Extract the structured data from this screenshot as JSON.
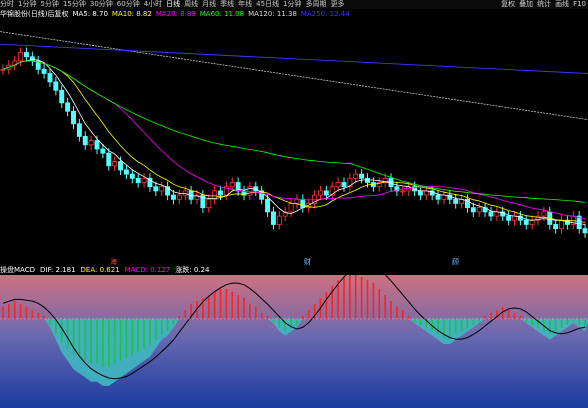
{
  "toolbar": {
    "items": [
      "分时",
      "1分钟",
      "5分钟",
      "15分钟",
      "30分钟",
      "60分钟",
      "4小时",
      "日线",
      "周线",
      "月线",
      "季线",
      "年线",
      "45日线",
      "1分钟",
      "多周期",
      "更多"
    ],
    "right": [
      "复权",
      "叠加",
      "统计",
      "画线",
      "F10"
    ]
  },
  "legend": {
    "title": "华锦股份(日线)后复权",
    "ma5": "MA5: 8.70",
    "ma10": "MA10: 8.82",
    "ma20": "MA20: 8.89",
    "ma60": "MA60: 11.08",
    "ma120": "MA120: 11.38",
    "ma250": "MA250: 12.44"
  },
  "markers": {
    "a": "海",
    "b": "财",
    "c": "顾"
  },
  "macd_legend": {
    "name": "操盘MACD",
    "dif": "DIF: 2.181",
    "dea": "DEA: 0.621",
    "macd": "MACD: 0.127",
    "signal": "涨跌: 0.24"
  },
  "colors": {
    "up": "#ff3232",
    "down": "#54ffff",
    "ma5": "#ffffff",
    "ma10": "#ffff00",
    "ma20": "#ff00ff",
    "ma60": "#00ff00",
    "ma120": "#dddddd",
    "ma250": "#3a3aff"
  },
  "chart_data": [
    {
      "type": "candlestick",
      "title": "",
      "count": 100,
      "x": [
        0,
        1,
        2,
        3,
        4,
        5,
        6,
        7,
        8,
        9,
        10,
        11,
        12,
        13,
        14,
        15,
        16,
        17,
        18,
        19,
        20,
        21,
        22,
        23,
        24,
        25,
        26,
        27,
        28,
        29,
        30,
        31,
        32,
        33,
        34,
        35,
        36,
        37,
        38,
        39,
        40,
        41,
        42,
        43,
        44,
        45,
        46,
        47,
        48,
        49,
        50,
        51,
        52,
        53,
        54,
        55,
        56,
        57,
        58,
        59,
        60,
        61,
        62,
        63,
        64,
        65,
        66,
        67,
        68,
        69,
        70,
        71,
        72,
        73,
        74,
        75,
        76,
        77,
        78,
        79,
        80,
        81,
        82,
        83,
        84,
        85,
        86,
        87,
        88,
        89,
        90,
        91,
        92,
        93,
        94,
        95,
        96,
        97,
        98,
        99
      ],
      "close": [
        12.3,
        12.4,
        12.5,
        12.7,
        12.6,
        12.5,
        12.3,
        12.2,
        12.0,
        11.8,
        11.5,
        11.3,
        11.0,
        10.7,
        10.5,
        10.6,
        10.4,
        10.3,
        10.0,
        10.1,
        9.9,
        9.8,
        9.7,
        9.6,
        9.7,
        9.5,
        9.4,
        9.5,
        9.3,
        9.2,
        9.3,
        9.4,
        9.2,
        9.3,
        9.0,
        9.2,
        9.4,
        9.3,
        9.5,
        9.6,
        9.4,
        9.3,
        9.5,
        9.4,
        9.2,
        8.9,
        8.6,
        8.8,
        8.9,
        9.1,
        9.2,
        9.0,
        9.1,
        9.3,
        9.4,
        9.3,
        9.5,
        9.6,
        9.5,
        9.7,
        9.8,
        9.7,
        9.6,
        9.5,
        9.6,
        9.7,
        9.5,
        9.4,
        9.4,
        9.5,
        9.4,
        9.3,
        9.4,
        9.3,
        9.2,
        9.3,
        9.2,
        9.1,
        9.2,
        9.0,
        8.9,
        9.0,
        8.9,
        8.8,
        8.9,
        8.8,
        8.7,
        8.8,
        8.7,
        8.6,
        8.7,
        8.8,
        8.9,
        8.6,
        8.5,
        8.7,
        8.6,
        8.8,
        8.5,
        8.4
      ],
      "ylim": [
        7.8,
        13.5
      ]
    },
    {
      "type": "bar",
      "title": "",
      "series": [
        {
          "values": [
            0.4,
            0.5,
            0.6,
            0.5,
            0.4,
            0.3,
            0.2,
            0.1,
            -0.2,
            -0.5,
            -0.8,
            -1.0,
            -1.2,
            -1.3,
            -1.4,
            -1.5,
            -1.5,
            -1.6,
            -1.6,
            -1.5,
            -1.4,
            -1.3,
            -1.2,
            -1.1,
            -1.0,
            -0.9,
            -0.7,
            -0.5,
            -0.4,
            -0.2,
            0.1,
            0.3,
            0.5,
            0.6,
            0.7,
            0.8,
            0.9,
            1.0,
            1.0,
            0.9,
            0.8,
            0.7,
            0.5,
            0.4,
            0.2,
            0.1,
            -0.1,
            -0.3,
            -0.4,
            -0.3,
            -0.2,
            0.1,
            0.3,
            0.5,
            0.7,
            0.9,
            1.1,
            1.3,
            1.4,
            1.5,
            1.5,
            1.4,
            1.3,
            1.2,
            1.0,
            0.8,
            0.6,
            0.4,
            0.3,
            0.1,
            -0.1,
            -0.2,
            -0.3,
            -0.4,
            -0.5,
            -0.6,
            -0.6,
            -0.5,
            -0.4,
            -0.3,
            -0.2,
            -0.1,
            0.1,
            0.2,
            0.3,
            0.4,
            0.3,
            0.2,
            0.1,
            -0.1,
            -0.2,
            -0.3,
            -0.4,
            -0.5,
            -0.4,
            -0.3,
            -0.2,
            -0.1,
            -0.2,
            -0.3
          ]
        }
      ],
      "ylim": [
        -2.0,
        2.0
      ]
    }
  ]
}
